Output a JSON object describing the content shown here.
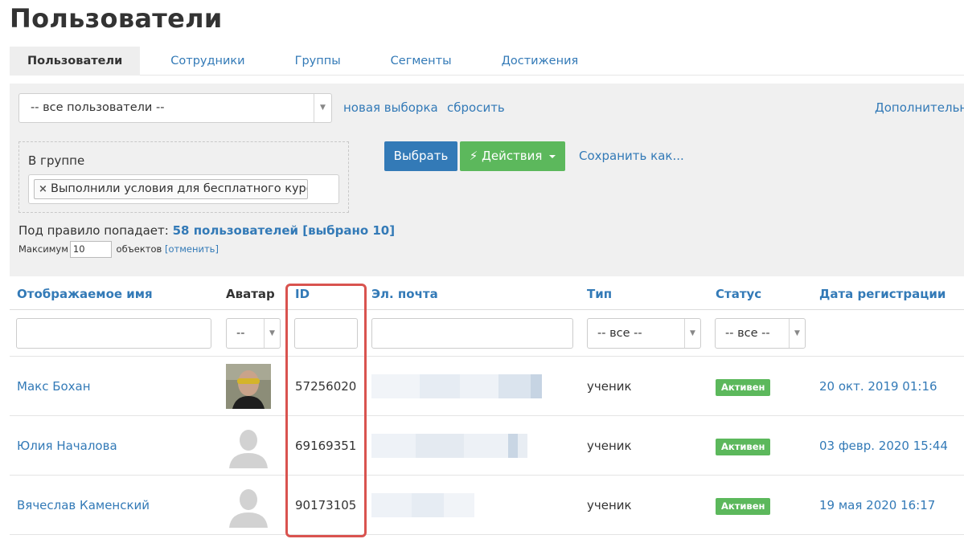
{
  "page": {
    "title": "Пользователи"
  },
  "tabs": [
    "Пользователи",
    "Сотрудники",
    "Группы",
    "Сегменты",
    "Достижения"
  ],
  "filter": {
    "select_value": "-- все пользователи --",
    "new_selection": "новая выборка",
    "reset": "сбросить",
    "additional": "Дополнительн",
    "group_label": "В группе",
    "group_tag": "Выполнили условия для бесплатного курса",
    "tag_remove": "×",
    "choose_button": "Выбрать",
    "actions_button": "Действия",
    "save_as": "Сохранить как...",
    "rule_prefix": "Под правило попадает:",
    "rule_count": "58 пользователей [выбрано 10]",
    "max_label": "Максимум",
    "max_value": "10",
    "objects_label": "объектов",
    "cancel_open": "[",
    "cancel": "отменить",
    "cancel_close": "]"
  },
  "table": {
    "columns": [
      "Отображаемое имя",
      "Аватар",
      "ID",
      "Эл. почта",
      "Тип",
      "Статус",
      "Дата регистрации"
    ],
    "filters": {
      "avatar": "--",
      "type": "-- все --",
      "status": "-- все --"
    },
    "rows": [
      {
        "name": "Макс Бохан",
        "id": "57256020",
        "type": "ученик",
        "status": "Активен",
        "date": "20 окт. 2019 01:16"
      },
      {
        "name": "Юлия Началова",
        "id": "69169351",
        "type": "ученик",
        "status": "Активен",
        "date": "03 февр. 2020 15:44"
      },
      {
        "name": "Вячеслав Каменский",
        "id": "90173105",
        "type": "ученик",
        "status": "Активен",
        "date": "19 мая 2020 16:17"
      }
    ]
  },
  "colors": {
    "link": "#337ab7",
    "primary": "#337ab7",
    "success": "#5cb85c",
    "highlight": "#d9534f"
  }
}
